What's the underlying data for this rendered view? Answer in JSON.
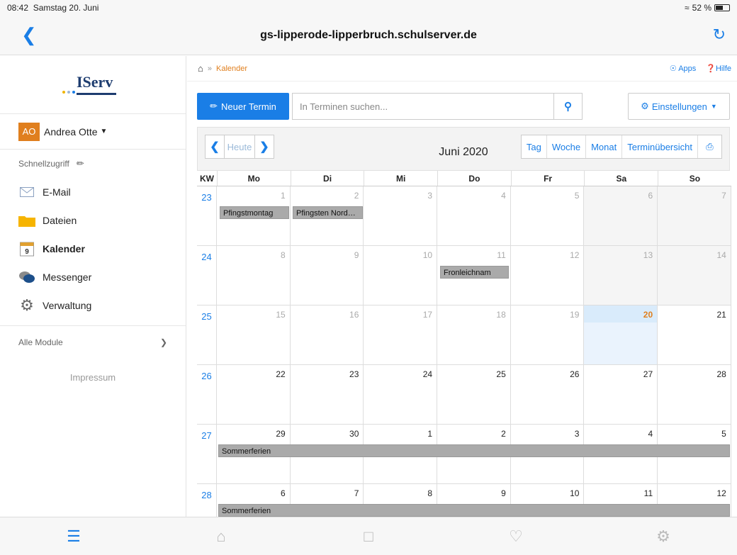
{
  "status": {
    "time": "08:42",
    "date": "Samstag 20. Juni",
    "battery": "52 %",
    "battery_level": 0.52
  },
  "navbar": {
    "title": "gs-lipperode-lipperbruch.schulserver.de"
  },
  "sidebar": {
    "brand": "IServ",
    "user": {
      "initials": "AO",
      "name": "Andrea Otte"
    },
    "quick_access": "Schnellzugriff",
    "items": [
      {
        "label": "E-Mail",
        "icon": "mail-icon"
      },
      {
        "label": "Dateien",
        "icon": "folder-icon"
      },
      {
        "label": "Kalender",
        "icon": "calendar-icon",
        "active": true
      },
      {
        "label": "Messenger",
        "icon": "chat-icon"
      },
      {
        "label": "Verwaltung",
        "icon": "gear-icon"
      }
    ],
    "all_modules": "Alle Module",
    "impressum": "Impressum"
  },
  "breadcrumb": {
    "current": "Kalender",
    "apps": "Apps",
    "help": "Hilfe"
  },
  "toolbar": {
    "new_event": "Neuer Termin",
    "search_placeholder": "In Terminen suchen...",
    "settings": "Einstellungen"
  },
  "calendar": {
    "today_label": "Heute",
    "month": "Juni 2020",
    "views": [
      "Tag",
      "Woche",
      "Monat",
      "Terminübersicht"
    ],
    "headers": [
      "KW",
      "Mo",
      "Di",
      "Mi",
      "Do",
      "Fr",
      "Sa",
      "So"
    ],
    "weeks": [
      {
        "kw": "23",
        "days": [
          "1",
          "2",
          "3",
          "4",
          "5",
          "6",
          "7"
        ]
      },
      {
        "kw": "24",
        "days": [
          "8",
          "9",
          "10",
          "11",
          "12",
          "13",
          "14"
        ]
      },
      {
        "kw": "25",
        "days": [
          "15",
          "16",
          "17",
          "18",
          "19",
          "20",
          "21"
        ]
      },
      {
        "kw": "26",
        "days": [
          "22",
          "23",
          "24",
          "25",
          "26",
          "27",
          "28"
        ]
      },
      {
        "kw": "27",
        "days": [
          "29",
          "30",
          "1",
          "2",
          "3",
          "4",
          "5"
        ]
      },
      {
        "kw": "28",
        "days": [
          "6",
          "7",
          "8",
          "9",
          "10",
          "11",
          "12"
        ]
      }
    ],
    "events": [
      {
        "title": "Pfingstmontag"
      },
      {
        "title": "Pfingsten Nord…"
      },
      {
        "title": "Fronleichnam"
      },
      {
        "title": "Sommerferien"
      },
      {
        "title": "Sommerferien"
      }
    ]
  },
  "colors": {
    "accent": "#1a7ee6",
    "orange": "#e07f1e"
  }
}
